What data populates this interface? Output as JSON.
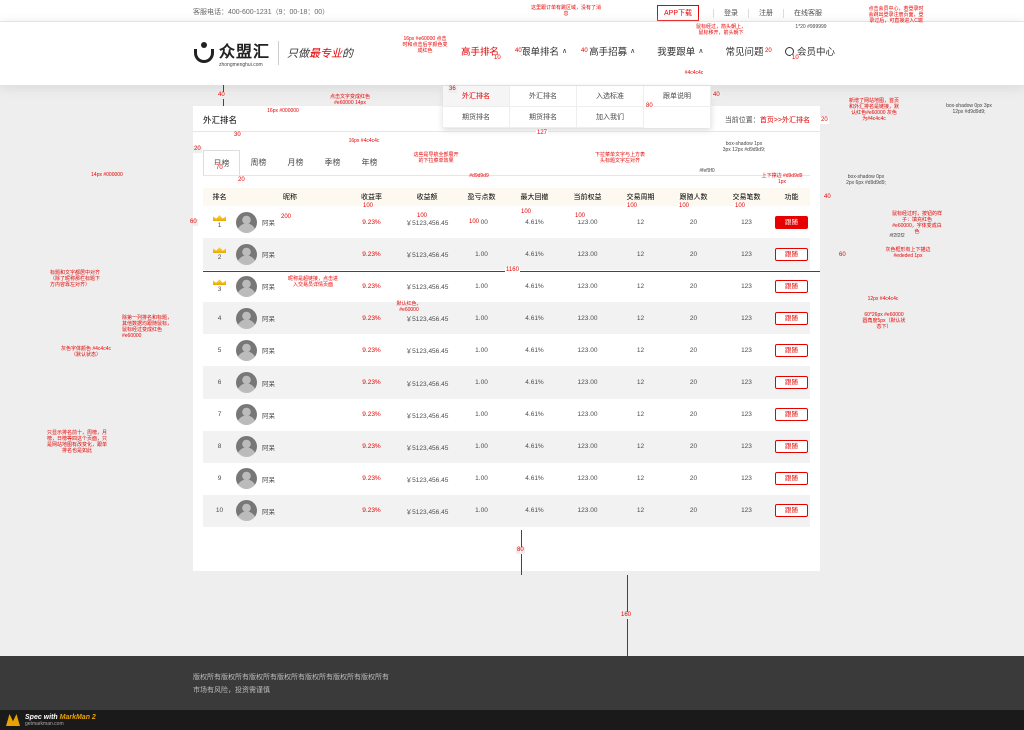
{
  "topbar": {
    "phone": "客服电话：400-600-1231（9：00-18：00）",
    "app_download": "APP下载",
    "links": [
      "登录",
      "注册",
      "在线客服"
    ]
  },
  "logo": {
    "name": "众盟汇",
    "url": "zhongmenghui.com",
    "slogan_pre": "只做",
    "slogan_hl": "最专业",
    "slogan_post": "的"
  },
  "nav": {
    "items": [
      {
        "label": "高手排名",
        "caret": "",
        "active": true
      },
      {
        "label": "跟单排名",
        "caret": "∧"
      },
      {
        "label": "高手招募",
        "caret": "∧"
      },
      {
        "label": "我要跟单",
        "caret": "∧"
      },
      {
        "label": "常见问题",
        "caret": ""
      }
    ],
    "member": "会员中心"
  },
  "dropdown": {
    "items": [
      "外汇排名",
      "外汇排名",
      "入选标准",
      "跟单说明",
      "期货排名",
      "期货排名",
      "加入我们",
      ""
    ]
  },
  "panel": {
    "title": "外汇排名",
    "crumb_label": "当前位置：",
    "crumb_link": "首页>>外汇排名",
    "tabs": [
      "日榜",
      "周榜",
      "月榜",
      "季榜",
      "年榜"
    ]
  },
  "table": {
    "headers": [
      "排名",
      "昵称",
      "收益率",
      "收益额",
      "盈亏点数",
      "最大回撤",
      "当前权益",
      "交易周期",
      "跟随人数",
      "交易笔数",
      "功能"
    ],
    "rows": [
      {
        "rank": "1",
        "name": "阿呆",
        "rate": "9.23%",
        "amount": "￥5123,456.45",
        "points": "1.00",
        "drawdown": "4.61%",
        "equity": "123.00",
        "period": "12",
        "followers": "20",
        "trades": "123",
        "action": "跟随"
      },
      {
        "rank": "2",
        "name": "阿呆",
        "rate": "9.23%",
        "amount": "￥5123,456.45",
        "points": "1.00",
        "drawdown": "4.61%",
        "equity": "123.00",
        "period": "12",
        "followers": "20",
        "trades": "123",
        "action": "跟随"
      },
      {
        "rank": "3",
        "name": "阿呆",
        "rate": "9.23%",
        "amount": "￥5123,456.45",
        "points": "1.00",
        "drawdown": "4.61%",
        "equity": "123.00",
        "period": "12",
        "followers": "20",
        "trades": "123",
        "action": "跟随"
      },
      {
        "rank": "4",
        "name": "阿呆",
        "rate": "9.23%",
        "amount": "￥5123,456.45",
        "points": "1.00",
        "drawdown": "4.61%",
        "equity": "123.00",
        "period": "12",
        "followers": "20",
        "trades": "123",
        "action": "跟随"
      },
      {
        "rank": "5",
        "name": "阿呆",
        "rate": "9.23%",
        "amount": "￥5123,456.45",
        "points": "1.00",
        "drawdown": "4.61%",
        "equity": "123.00",
        "period": "12",
        "followers": "20",
        "trades": "123",
        "action": "跟随"
      },
      {
        "rank": "6",
        "name": "阿呆",
        "rate": "9.23%",
        "amount": "￥5123,456.45",
        "points": "1.00",
        "drawdown": "4.61%",
        "equity": "123.00",
        "period": "12",
        "followers": "20",
        "trades": "123",
        "action": "跟随"
      },
      {
        "rank": "7",
        "name": "阿呆",
        "rate": "9.23%",
        "amount": "￥5123,456.45",
        "points": "1.00",
        "drawdown": "4.61%",
        "equity": "123.00",
        "period": "12",
        "followers": "20",
        "trades": "123",
        "action": "跟随"
      },
      {
        "rank": "8",
        "name": "阿呆",
        "rate": "9.23%",
        "amount": "￥5123,456.45",
        "points": "1.00",
        "drawdown": "4.61%",
        "equity": "123.00",
        "period": "12",
        "followers": "20",
        "trades": "123",
        "action": "跟随"
      },
      {
        "rank": "9",
        "name": "阿呆",
        "rate": "9.23%",
        "amount": "￥5123,456.45",
        "points": "1.00",
        "drawdown": "4.61%",
        "equity": "123.00",
        "period": "12",
        "followers": "20",
        "trades": "123",
        "action": "跟随"
      },
      {
        "rank": "10",
        "name": "阿呆",
        "rate": "9.23%",
        "amount": "￥5123,456.45",
        "points": "1.00",
        "drawdown": "4.61%",
        "equity": "123.00",
        "period": "12",
        "followers": "20",
        "trades": "123",
        "action": "跟随"
      }
    ]
  },
  "footer": {
    "line1": "版权所有版权所有版权所有版权所有版权所有版权所有版权所有",
    "line2": "市场有风险，投资需谨慎"
  },
  "spec": {
    "pre": "Spec with ",
    "brand": "MarkMan 2",
    "url": "getmarkman.com"
  },
  "annotations": {
    "a_app": "这里跟订单有跳区域，没有了消息",
    "a_nav_red": "16px #e60000 点击时和点击后字颜色变成红色",
    "a_hover": "鼠标经过，箭头朝上，鼠标移开，箭头朝下",
    "a_top_sep": "1*20 #999999",
    "a_member": "点击会员中心，若登录时会跳出登录注册页面，登录过后，可直接进入C端",
    "a_box_shadow_nav": "box-shadow 0px 3px 12px #d9d9d9;",
    "a_nav_color": "#4c4c4c",
    "a_dd_red": "点击文字变成红色#e60000 14px",
    "a_title": "16px #000000",
    "a_tab": "16px #4c4c4c",
    "a_dd_note": "这些是导航全部展开的下拉菜单效果",
    "a_dd_bg": "#d9d9d9",
    "a_dd_align": "下拉菜单文字与上方表头标题文字左对齐",
    "a_dd_shadow": "box-shadow 1px 3px 12px #d9d9d9;",
    "a_crumb": "新增了网站地图，首页和外汇排名是链接，默认红色#e60000 灰色为#4c4c4c",
    "a_head_bg": "#fef9f0",
    "a_head_pad": "上下撑边 #d9d9d9 1px",
    "a_panel_shadow": "box-shadow 0px 2px 6px #d9d9d9;",
    "a_14": "14px #000000",
    "a_btn_hover": "鼠标经过时，按钮的样子：填充红色#e60000，字体变成白色",
    "a_row_bg": "#f2f2f2",
    "a_row_border": "灰色框形有上下描边 #ededed 1px",
    "a_cell": "12px #4c4c4c",
    "a_btn_spec": "60*26px #e60000 圆角度5px（默认状态下）",
    "a_name_link": "昵称是超链接，点击进入交易员详情页面",
    "a_rate_red": "默认红色，#e60000",
    "a_align": "标题和文字都居中对齐（除了昵称那栏标题下方内容靠左对齐）",
    "a_rank_col": "除第一列排名和标题，其他数据均跟随鼠标，鼠标经过变成红色#e60000",
    "a_gray": "灰色字体颜色 #4c4c4c（默认状态）",
    "a_paging": "只显示排名前十，周榜，月榜，日榜等四这个页面，只是网站地图有改变化，跟单排名也是如此"
  },
  "dims": {
    "d40a": "40",
    "d10": "10",
    "d40b": "40",
    "d40c": "40",
    "d20a": "20",
    "d10b": "10",
    "d36": "36",
    "d80a": "80",
    "d40d": "40",
    "d40e": "40",
    "d30": "30",
    "d127": "127",
    "d20b": "20",
    "d20c": "20",
    "d70": "70",
    "d20d": "20",
    "d60a": "60",
    "d200": "200",
    "d100a": "100",
    "d100b": "100",
    "d100c": "100",
    "d100d": "100",
    "d100e": "100",
    "d100f": "100",
    "d100g": "100",
    "d100h": "100",
    "d40f": "40",
    "d60b": "60",
    "d60c": "60",
    "d1160": "1160",
    "d80b": "80",
    "d160": "160"
  }
}
